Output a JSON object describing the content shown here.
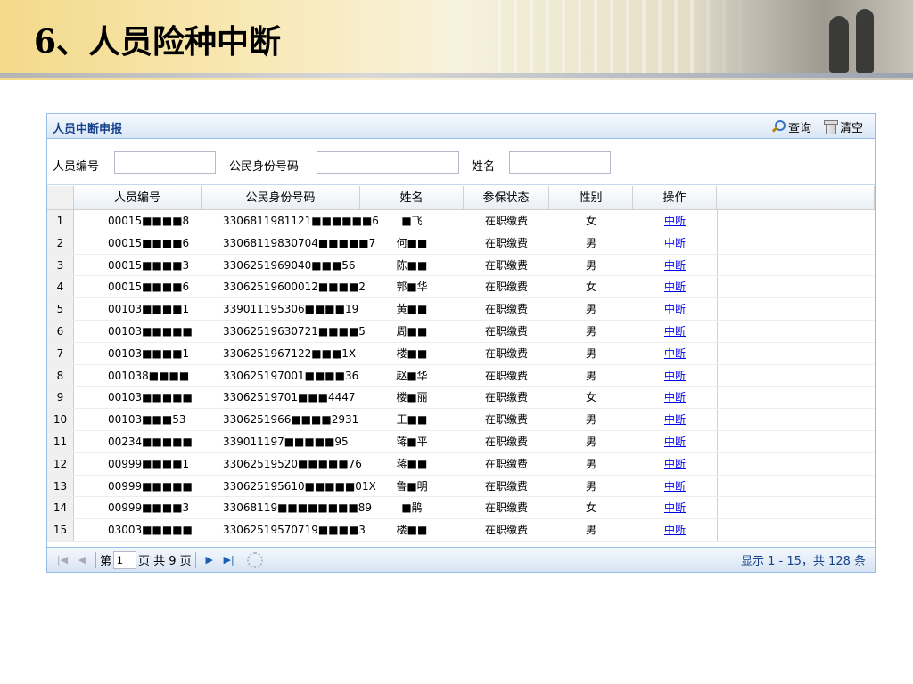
{
  "slide": {
    "title": "6、人员险种中断"
  },
  "panel": {
    "title": "人员中断申报",
    "tools": {
      "query": "查询",
      "clear": "清空"
    }
  },
  "search": {
    "person_id_label": "人员编号",
    "id_card_label": "公民身份号码",
    "name_label": "姓名",
    "person_id_value": "",
    "id_card_value": "",
    "name_value": ""
  },
  "grid": {
    "columns": [
      "人员编号",
      "公民身份号码",
      "姓名",
      "参保状态",
      "性别",
      "操作"
    ],
    "rows": [
      {
        "n": "1",
        "id": "00015■■■■8",
        "card": "3306811981121■■■■■■6",
        "name": "■飞",
        "status": "在职缴费",
        "sex": "女",
        "op": "中断"
      },
      {
        "n": "2",
        "id": "00015■■■■6",
        "card": "33068119830704■■■■■7",
        "name": "何■■",
        "status": "在职缴费",
        "sex": "男",
        "op": "中断"
      },
      {
        "n": "3",
        "id": "00015■■■■3",
        "card": "3306251969040■■■56",
        "name": "陈■■",
        "status": "在职缴费",
        "sex": "男",
        "op": "中断"
      },
      {
        "n": "4",
        "id": "00015■■■■6",
        "card": "33062519600012■■■■2",
        "name": "郭■华",
        "status": "在职缴费",
        "sex": "女",
        "op": "中断"
      },
      {
        "n": "5",
        "id": "00103■■■■1",
        "card": "339011195306■■■■19",
        "name": "黄■■",
        "status": "在职缴费",
        "sex": "男",
        "op": "中断"
      },
      {
        "n": "6",
        "id": "00103■■■■■",
        "card": "33062519630721■■■■5",
        "name": "周■■",
        "status": "在职缴费",
        "sex": "男",
        "op": "中断"
      },
      {
        "n": "7",
        "id": "00103■■■■1",
        "card": "3306251967122■■■1X",
        "name": "楼■■",
        "status": "在职缴费",
        "sex": "男",
        "op": "中断"
      },
      {
        "n": "8",
        "id": "001038■■■■",
        "card": "330625197001■■■■36",
        "name": "赵■华",
        "status": "在职缴费",
        "sex": "男",
        "op": "中断"
      },
      {
        "n": "9",
        "id": "00103■■■■■",
        "card": "33062519701■■■4447",
        "name": "楼■丽",
        "status": "在职缴费",
        "sex": "女",
        "op": "中断"
      },
      {
        "n": "10",
        "id": "00103■■■53",
        "card": "3306251966■■■■2931",
        "name": "王■■",
        "status": "在职缴费",
        "sex": "男",
        "op": "中断"
      },
      {
        "n": "11",
        "id": "00234■■■■■",
        "card": "339011197■■■■■95",
        "name": "蒋■平",
        "status": "在职缴费",
        "sex": "男",
        "op": "中断"
      },
      {
        "n": "12",
        "id": "00999■■■■1",
        "card": "33062519520■■■■■76",
        "name": "蒋■■",
        "status": "在职缴费",
        "sex": "男",
        "op": "中断"
      },
      {
        "n": "13",
        "id": "00999■■■■■",
        "card": "330625195610■■■■■01X",
        "name": "鲁■明",
        "status": "在职缴费",
        "sex": "男",
        "op": "中断"
      },
      {
        "n": "14",
        "id": "00999■■■■3",
        "card": "33068119■■■■■■■■89",
        "name": "■鹃",
        "status": "在职缴费",
        "sex": "女",
        "op": "中断"
      },
      {
        "n": "15",
        "id": "03003■■■■■",
        "card": "33062519570719■■■■3",
        "name": "楼■■",
        "status": "在职缴费",
        "sex": "男",
        "op": "中断"
      }
    ]
  },
  "pager": {
    "page_prefix": "第",
    "page_value": "1",
    "page_suffix": "页 共 9 页",
    "info": "显示 1 - 15，共 128 条"
  }
}
